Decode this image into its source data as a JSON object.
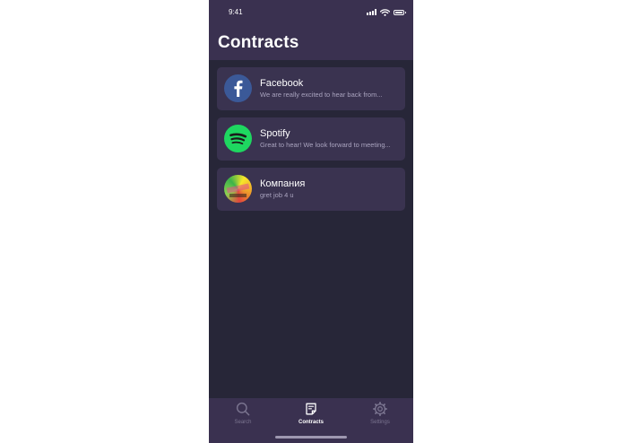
{
  "status_bar": {
    "time": "9:41",
    "icons": [
      "signal-icon",
      "wifi-icon",
      "battery-icon"
    ]
  },
  "header": {
    "title": "Contracts"
  },
  "contacts": [
    {
      "name": "Facebook",
      "preview": "We are really excited to hear back from...",
      "avatar": "facebook-logo-icon"
    },
    {
      "name": "Spotify",
      "preview": "Great to hear! We look forward to meeting...",
      "avatar": "spotify-logo-icon"
    },
    {
      "name": "Компания",
      "preview": "gret job 4 u",
      "avatar": "company-avatar"
    }
  ],
  "tab_bar": {
    "tabs": [
      {
        "label": "Search",
        "icon": "search-icon",
        "active": false
      },
      {
        "label": "Contracts",
        "icon": "document-icon",
        "active": true
      },
      {
        "label": "Settings",
        "icon": "gear-icon",
        "active": false
      }
    ]
  },
  "colors": {
    "background": "#272638",
    "header": "#3a3150",
    "card": "#3a3350",
    "facebook": "#3b5998",
    "spotify": "#1ed760",
    "active_tab": "#ffffff",
    "inactive_tab": "#7b7590"
  }
}
